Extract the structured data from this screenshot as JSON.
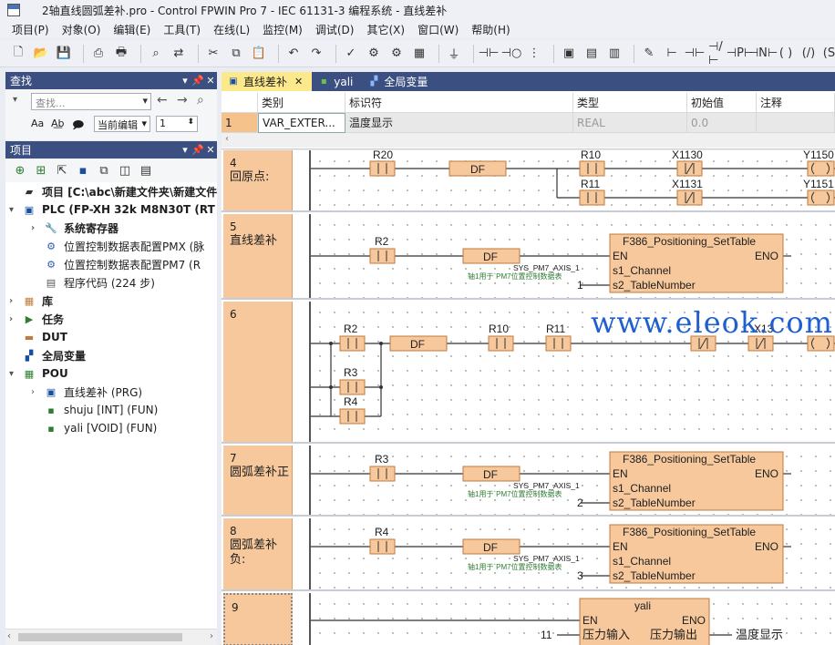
{
  "window": {
    "title": "2轴直线圆弧差补.pro - Control FPWIN Pro 7 - IEC 61131-3 编程系统 - 直线差补"
  },
  "menu": [
    "项目(P)",
    "对象(O)",
    "编辑(E)",
    "工具(T)",
    "在线(L)",
    "监控(M)",
    "调试(D)",
    "其它(X)",
    "窗口(W)",
    "帮助(H)"
  ],
  "find_panel": {
    "title": "查找",
    "search_placeholder": "查找...",
    "scope": "当前编辑",
    "count": "1"
  },
  "project_panel": {
    "title": "项目",
    "tree": [
      {
        "label": "项目 [C:\\abc\\新建文件夹\\新建文件夹",
        "level": 0,
        "expander": "",
        "icon": "project-icon",
        "bold": true
      },
      {
        "label": "PLC (FP-XH 32k M8N30T (RT",
        "level": 0,
        "expander": "▾",
        "icon": "plc-icon",
        "bold": true
      },
      {
        "label": "系统寄存器",
        "level": 1,
        "expander": "›",
        "icon": "wrench-icon",
        "bold": true
      },
      {
        "label": "位置控制数据表配置PMX (脉",
        "level": 1,
        "expander": "",
        "icon": "gear-table-icon",
        "bold": false
      },
      {
        "label": "位置控制数据表配置PM7 (R",
        "level": 1,
        "expander": "",
        "icon": "gear-table-icon",
        "bold": false
      },
      {
        "label": "程序代码 (224 步)",
        "level": 1,
        "expander": "",
        "icon": "code-icon",
        "bold": false
      },
      {
        "label": "库",
        "level": 0,
        "expander": "›",
        "icon": "library-icon",
        "bold": true
      },
      {
        "label": "任务",
        "level": 0,
        "expander": "›",
        "icon": "task-icon",
        "bold": true
      },
      {
        "label": "DUT",
        "level": 0,
        "expander": "",
        "icon": "dut-icon",
        "bold": true
      },
      {
        "label": "全局变量",
        "level": 0,
        "expander": "",
        "icon": "global-var-icon",
        "bold": true
      },
      {
        "label": "POU",
        "level": 0,
        "expander": "▾",
        "icon": "pou-icon",
        "bold": true
      },
      {
        "label": "直线差补 (PRG)",
        "level": 1,
        "expander": "›",
        "icon": "prg-icon",
        "bold": false
      },
      {
        "label": "shuju [INT] (FUN)",
        "level": 1,
        "expander": "",
        "icon": "fun-icon",
        "bold": false
      },
      {
        "label": "yali [VOID] (FUN)",
        "level": 1,
        "expander": "",
        "icon": "fun-icon",
        "bold": false
      }
    ]
  },
  "tabs": [
    {
      "label": "直线差补",
      "active": true
    },
    {
      "label": "yali",
      "active": false
    },
    {
      "label": "全局变量",
      "active": false
    }
  ],
  "var_table": {
    "headers": [
      "",
      "类别",
      "标识符",
      "类型",
      "初始值",
      "注释"
    ],
    "rows": [
      [
        "1",
        "VAR_EXTER...",
        "温度显示",
        "REAL",
        "0.0",
        ""
      ]
    ]
  },
  "ladder": {
    "watermark": "www.eleok.com",
    "networks": [
      {
        "num": "4",
        "label": "回原点:"
      },
      {
        "num": "5",
        "label": "直线差补"
      },
      {
        "num": "6",
        "label": ""
      },
      {
        "num": "7",
        "label": "圆弧差补正"
      },
      {
        "num": "8",
        "label": "圆弧差补负:"
      },
      {
        "num": "9",
        "label": ""
      }
    ],
    "text": {
      "r20": "R20",
      "r10": "R10",
      "r11": "R11",
      "x1130": "X1130",
      "x1131": "X1131",
      "y1150": "Y1150",
      "y1151": "Y1151",
      "df": "DF",
      "r2": "R2",
      "r3": "R3",
      "r4": "R4",
      "x13": "X13",
      "fb_name": "F386_Positioning_SetTable",
      "en": "EN",
      "eno": "ENO",
      "s1": "s1_Channel",
      "s2": "s2_TableNumber",
      "sys_axis": "SYS_PM7_AXIS_1",
      "axis_comment": "轴1用于`PM7位置控制数据表",
      "table1": "1",
      "table2": "2",
      "table3": "3",
      "yali": "yali",
      "in_pin": "压力输入",
      "out_pin": "压力输出",
      "in_val": "11",
      "out_var": "温度显示"
    }
  }
}
